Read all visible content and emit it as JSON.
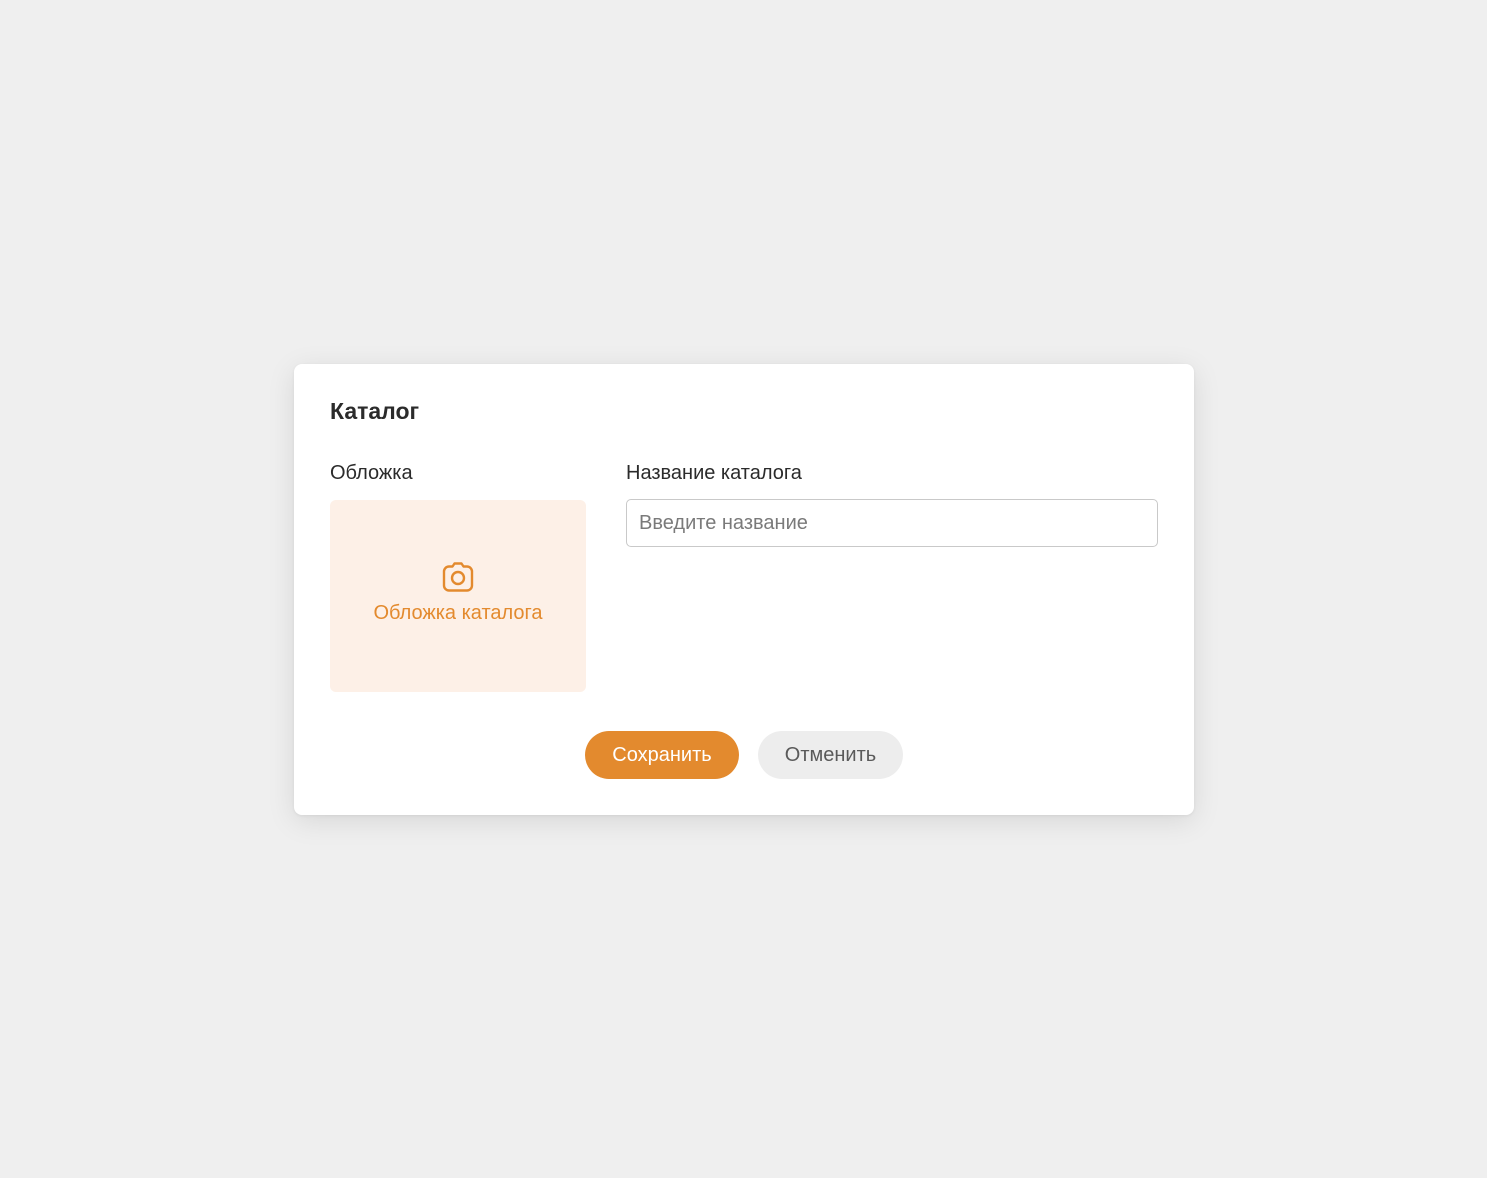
{
  "dialog": {
    "title": "Каталог",
    "cover": {
      "label": "Обложка",
      "upload_text": "Обложка каталога",
      "icon": "camera-icon"
    },
    "name": {
      "label": "Название каталога",
      "placeholder": "Введите название",
      "value": ""
    },
    "actions": {
      "save_label": "Сохранить",
      "cancel_label": "Отменить"
    }
  },
  "colors": {
    "accent": "#e38a2e",
    "accent_light": "#fdf0e7",
    "page_background": "#efefef",
    "cancel_background": "#ededed"
  }
}
